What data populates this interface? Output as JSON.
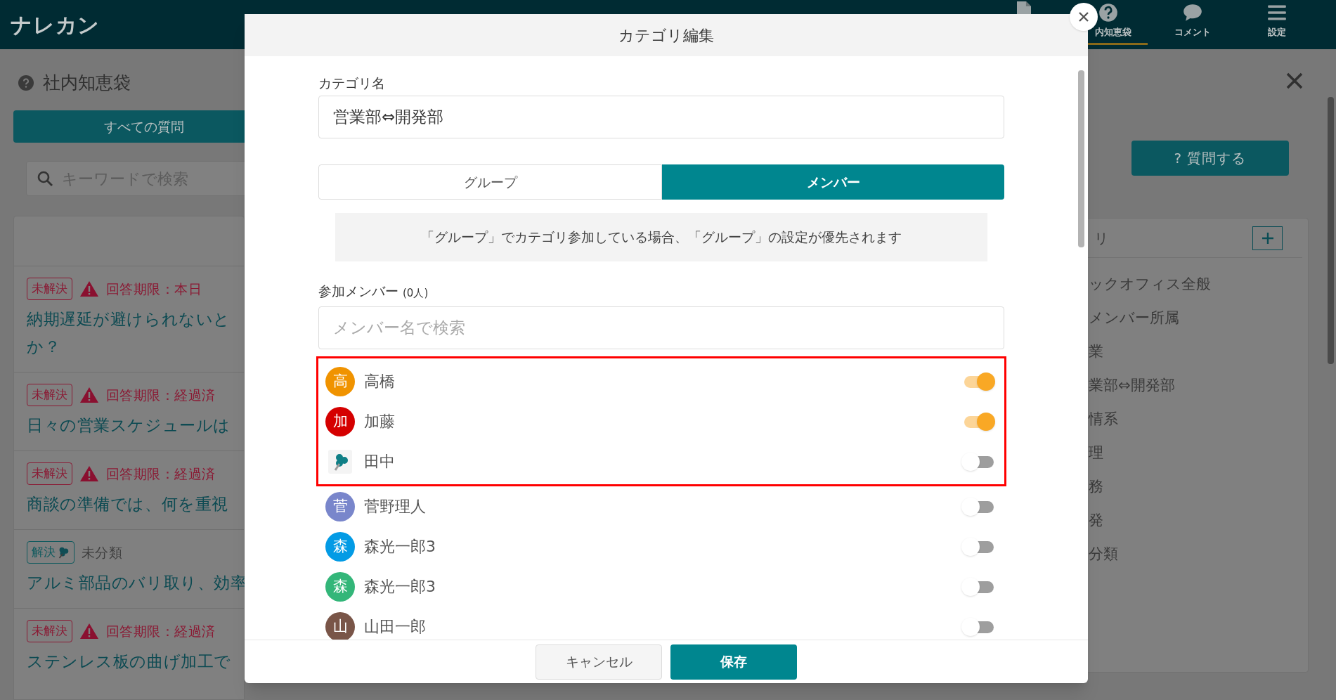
{
  "app": {
    "logo": "ナレカン"
  },
  "header_tabs": [
    {
      "kind": "question",
      "label": "内知恵袋",
      "selected": true
    },
    {
      "kind": "comment",
      "label": "コメント",
      "selected": false
    },
    {
      "kind": "menu",
      "label": "設定",
      "selected": false
    }
  ],
  "left_panel": {
    "title": "社内知恵袋",
    "all_button": "すべての質問",
    "search": {
      "placeholder": "キーワードで検索"
    },
    "questions": [
      {
        "status": "未解決",
        "resolved": false,
        "meta": "回答期限：本日",
        "title_lines": [
          "納期遅延が避けられないと",
          "か？"
        ]
      },
      {
        "status": "未解決",
        "resolved": false,
        "meta": "回答期限：経過済",
        "title_lines": [
          "日々の営業スケジュールは"
        ]
      },
      {
        "status": "未解決",
        "resolved": false,
        "meta": "回答期限：経過済",
        "title_lines": [
          "商談の準備では、何を重視"
        ]
      },
      {
        "status": "解決",
        "resolved": true,
        "meta": "未分類",
        "title_lines": [
          "アルミ部品のバリ取り、効率"
        ]
      },
      {
        "status": "未解決",
        "resolved": false,
        "meta": "回答期限：経過済",
        "title_lines": [
          "ステンレス板の曲げ加工で"
        ]
      }
    ]
  },
  "right_panel": {
    "ask_button": "? 質問する",
    "card_title": "リ",
    "categories": [
      "ックオフィス全般",
      "メンバー所属",
      "業",
      "業部⇔開発部",
      "情系",
      "理",
      "務",
      "発",
      "分類"
    ]
  },
  "dialog": {
    "title": "カテゴリ編集",
    "name_label": "カテゴリ名",
    "name_value": "営業部⇔開発部",
    "tabs": [
      {
        "label": "グループ",
        "selected": false
      },
      {
        "label": "メンバー",
        "selected": true
      }
    ],
    "note": "「グループ」でカテゴリ参加している場合、「グループ」の設定が優先されます",
    "members_label": "参加メンバー",
    "members_count": "(0人)",
    "member_search": {
      "placeholder": "メンバー名で検索"
    },
    "members": [
      {
        "kind": "initial",
        "initial": "高",
        "color": "#f09300",
        "name": "高橋",
        "on": true,
        "highlighted": true
      },
      {
        "kind": "initial",
        "initial": "加",
        "color": "#d50000",
        "name": "加藤",
        "on": true,
        "highlighted": true
      },
      {
        "kind": "image",
        "name": "田中",
        "on": false,
        "highlighted": true
      },
      {
        "kind": "initial",
        "initial": "菅",
        "color": "#7986cb",
        "name": "菅野理人",
        "on": false,
        "highlighted": false
      },
      {
        "kind": "initial",
        "initial": "森",
        "color": "#039be5",
        "name": "森光一郎3",
        "on": false,
        "highlighted": false
      },
      {
        "kind": "initial",
        "initial": "森",
        "color": "#33b679",
        "name": "森光一郎3",
        "on": false,
        "highlighted": false
      },
      {
        "kind": "initial",
        "initial": "山",
        "color": "#795548",
        "name": "山田一郎",
        "on": false,
        "highlighted": false
      }
    ],
    "buttons": [
      {
        "kind": "cancel",
        "label": "キャンセル"
      },
      {
        "kind": "save",
        "label": "保存"
      }
    ]
  }
}
